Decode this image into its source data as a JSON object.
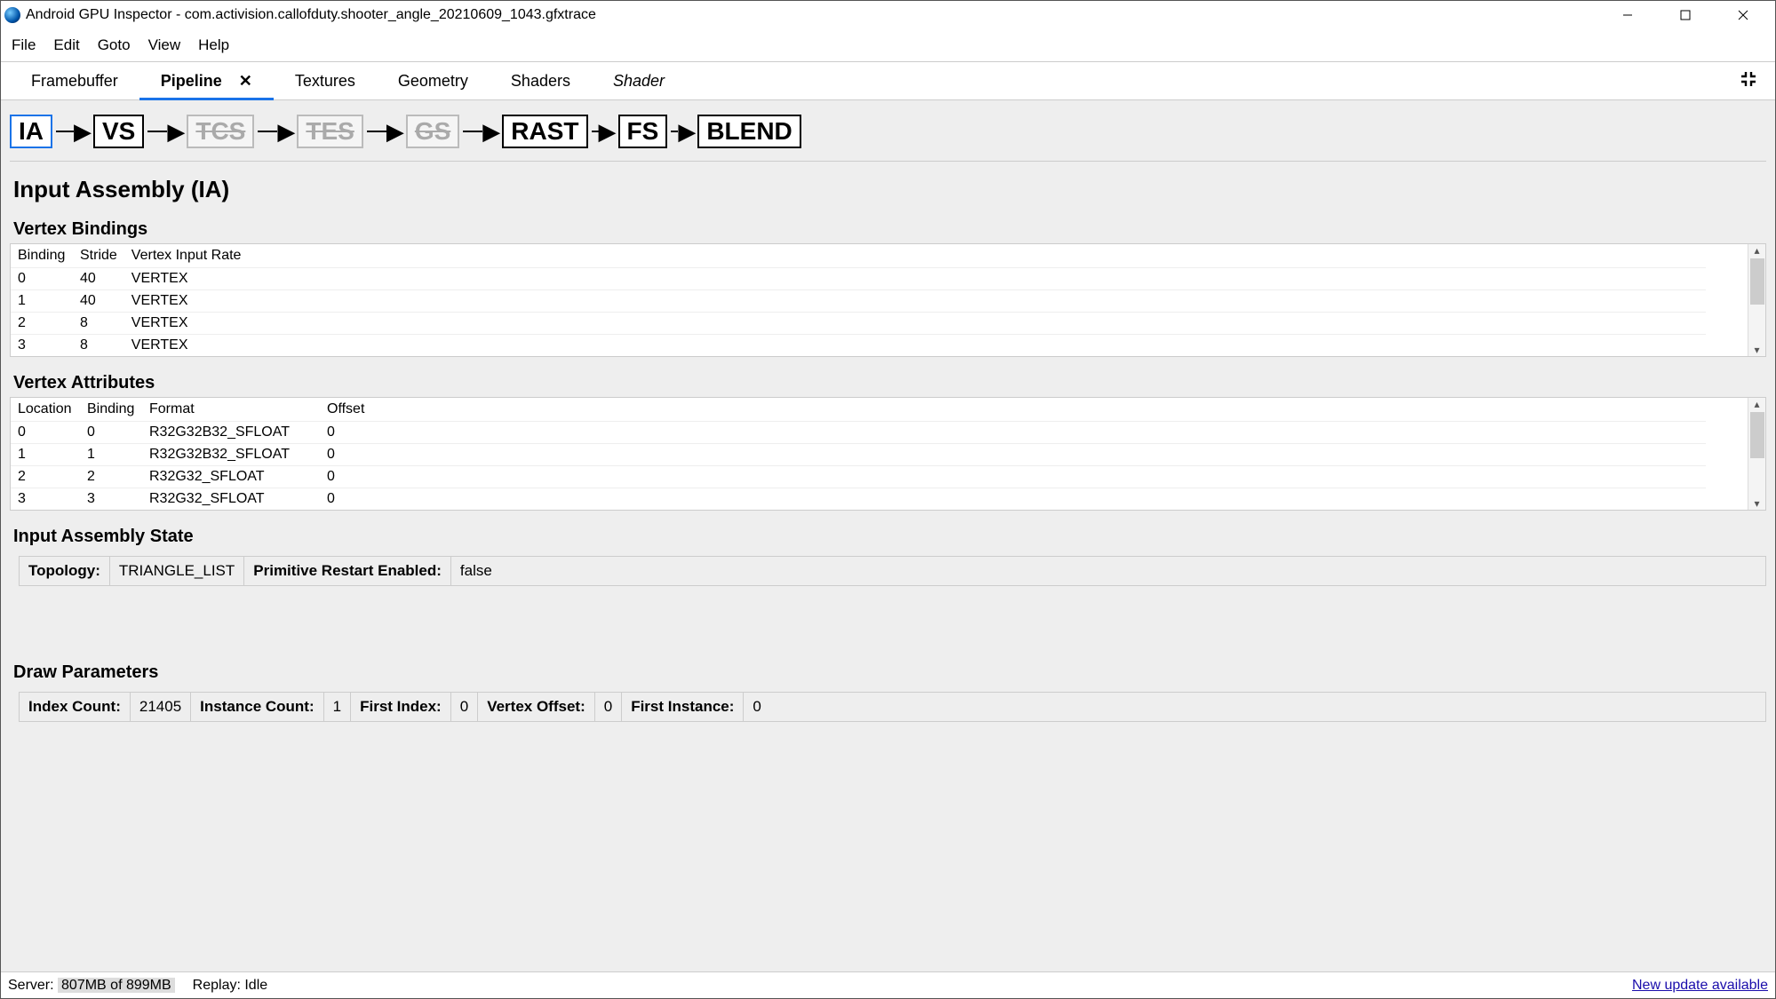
{
  "window": {
    "title": "Android GPU Inspector - com.activision.callofduty.shooter_angle_20210609_1043.gfxtrace"
  },
  "menu": {
    "file": "File",
    "edit": "Edit",
    "goto": "Goto",
    "view": "View",
    "help": "Help"
  },
  "tabs": {
    "framebuffer": "Framebuffer",
    "pipeline": "Pipeline",
    "textures": "Textures",
    "geometry": "Geometry",
    "shaders": "Shaders",
    "shader": "Shader"
  },
  "stages": {
    "ia": "IA",
    "vs": "VS",
    "tcs": "TCS",
    "tes": "TES",
    "gs": "GS",
    "rast": "RAST",
    "fs": "FS",
    "blend": "BLEND"
  },
  "section": {
    "heading": "Input Assembly (IA)",
    "vbindings": "Vertex Bindings",
    "vattrs": "Vertex Attributes",
    "iastate": "Input Assembly State",
    "drawparams": "Draw Parameters"
  },
  "vbindings": {
    "cols": {
      "binding": "Binding",
      "stride": "Stride",
      "vir": "Vertex Input Rate"
    },
    "rows": [
      {
        "binding": "0",
        "stride": "40",
        "vir": "VERTEX"
      },
      {
        "binding": "1",
        "stride": "40",
        "vir": "VERTEX"
      },
      {
        "binding": "2",
        "stride": "8",
        "vir": "VERTEX"
      },
      {
        "binding": "3",
        "stride": "8",
        "vir": "VERTEX"
      }
    ]
  },
  "vattrs": {
    "cols": {
      "location": "Location",
      "binding": "Binding",
      "format": "Format",
      "offset": "Offset"
    },
    "rows": [
      {
        "location": "0",
        "binding": "0",
        "format": "R32G32B32_SFLOAT",
        "offset": "0"
      },
      {
        "location": "1",
        "binding": "1",
        "format": "R32G32B32_SFLOAT",
        "offset": "0"
      },
      {
        "location": "2",
        "binding": "2",
        "format": "R32G32_SFLOAT",
        "offset": "0"
      },
      {
        "location": "3",
        "binding": "3",
        "format": "R32G32_SFLOAT",
        "offset": "0"
      }
    ]
  },
  "iastate": {
    "topology_label": "Topology:",
    "topology_value": "TRIANGLE_LIST",
    "primrestart_label": "Primitive Restart Enabled:",
    "primrestart_value": "false"
  },
  "drawparams": {
    "indexcount_label": "Index Count:",
    "indexcount_value": "21405",
    "instancecount_label": "Instance Count:",
    "instancecount_value": "1",
    "firstindex_label": "First Index:",
    "firstindex_value": "0",
    "vertexoffset_label": "Vertex Offset:",
    "vertexoffset_value": "0",
    "firstinstance_label": "First Instance:",
    "firstinstance_value": "0"
  },
  "status": {
    "server_label": "Server:",
    "server_value": "807MB of 899MB",
    "replay_label": "Replay:",
    "replay_value": "Idle",
    "update": "New update available"
  }
}
